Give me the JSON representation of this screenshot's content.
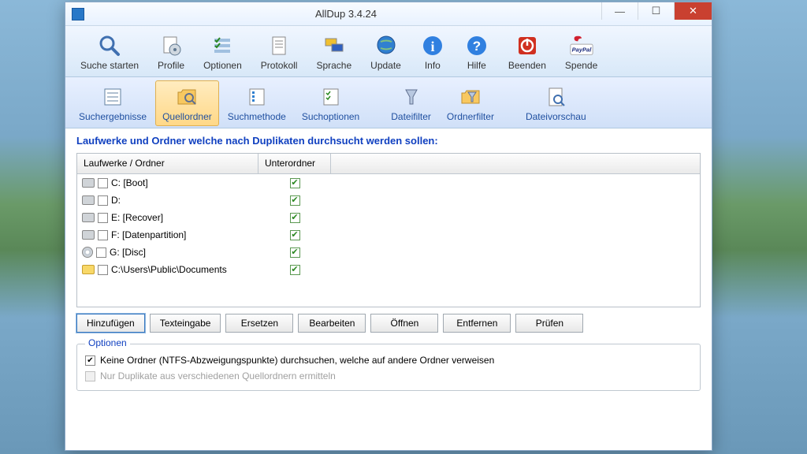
{
  "window_title": "AllDup 3.4.24",
  "toolbar1": [
    {
      "label": "Suche starten",
      "icon": "search"
    },
    {
      "label": "Profile",
      "icon": "gear-doc"
    },
    {
      "label": "Optionen",
      "icon": "checklist"
    },
    {
      "label": "Protokoll",
      "icon": "doc"
    },
    {
      "label": "Sprache",
      "icon": "flags"
    },
    {
      "label": "Update",
      "icon": "globe"
    },
    {
      "label": "Info",
      "icon": "info"
    },
    {
      "label": "Hilfe",
      "icon": "help"
    },
    {
      "label": "Beenden",
      "icon": "power"
    },
    {
      "label": "Spende",
      "icon": "paypal"
    }
  ],
  "toolbar2": [
    {
      "label": "Suchergebnisse",
      "icon": "results",
      "active": false
    },
    {
      "label": "Quellordner",
      "icon": "folder-search",
      "active": true
    },
    {
      "label": "Suchmethode",
      "icon": "method",
      "active": false
    },
    {
      "label": "Suchoptionen",
      "icon": "options",
      "active": false
    },
    {
      "label": "Dateifilter",
      "icon": "filter-file",
      "active": false
    },
    {
      "label": "Ordnerfilter",
      "icon": "filter-folder",
      "active": false
    },
    {
      "label": "Dateivorschau",
      "icon": "preview",
      "active": false
    }
  ],
  "section_title": "Laufwerke und Ordner welche nach Duplikaten durchsucht werden sollen:",
  "columns": {
    "c1": "Laufwerke / Ordner",
    "c2": "Unterordner"
  },
  "drives": [
    {
      "label": "C: [Boot]",
      "type": "hdd",
      "checked": false,
      "sub": true
    },
    {
      "label": "D:",
      "type": "hdd",
      "checked": false,
      "sub": true
    },
    {
      "label": "E: [Recover]",
      "type": "hdd",
      "checked": false,
      "sub": true
    },
    {
      "label": "F: [Datenpartition]",
      "type": "hdd",
      "checked": false,
      "sub": true
    },
    {
      "label": "G: [Disc]",
      "type": "disc",
      "checked": false,
      "sub": true
    },
    {
      "label": "C:\\Users\\Public\\Documents",
      "type": "folder",
      "checked": false,
      "sub": true
    }
  ],
  "buttons": [
    "Hinzufügen",
    "Texteingabe",
    "Ersetzen",
    "Bearbeiten",
    "Öffnen",
    "Entfernen",
    "Prüfen"
  ],
  "options_title": "Optionen",
  "opt1": "Keine Ordner (NTFS-Abzweigungspunkte) durchsuchen, welche auf andere Ordner verweisen",
  "opt2": "Nur Duplikate aus verschiedenen Quellordnern ermitteln"
}
